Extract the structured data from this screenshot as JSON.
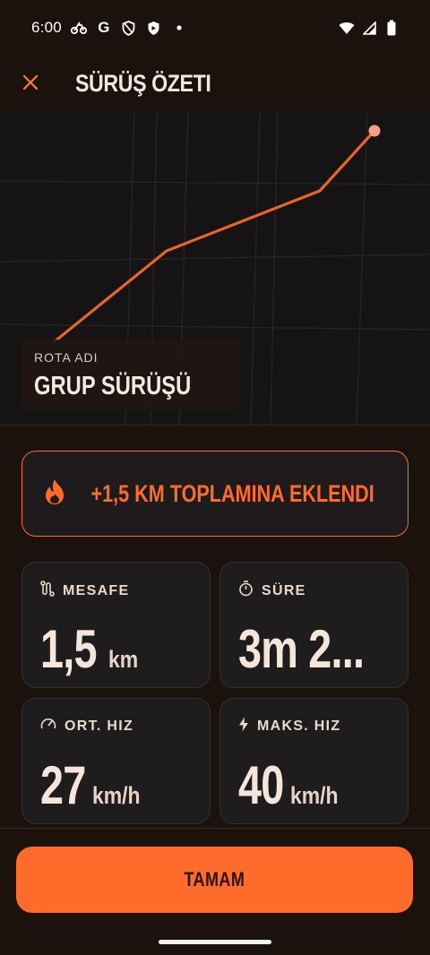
{
  "status_bar": {
    "time": "6:00",
    "left_icons": [
      "bike-notification-icon",
      "google-icon",
      "shield-icon",
      "vpn-shield-icon",
      "dot-icon"
    ],
    "right_icons": [
      "wifi-icon",
      "signal-icon",
      "battery-icon"
    ]
  },
  "header": {
    "title": "SÜRÜŞ ÖZETI"
  },
  "map": {
    "route_label": "ROTA ADI",
    "route_name": "GRUP SÜRÜŞÜ",
    "route_color": "#e8652a",
    "end_marker_color": "#f4a182"
  },
  "banner": {
    "text": "+1,5 KM TOPLAMINA EKLENDI",
    "icon": "flame-icon",
    "accent": "#ff6b2b"
  },
  "stats": {
    "distance": {
      "label": "MESAFE",
      "value": "1,5",
      "unit": "km",
      "icon": "route-icon"
    },
    "duration": {
      "label": "SÜRE",
      "value": "3m 2...",
      "unit": "",
      "icon": "stopwatch-icon"
    },
    "avg_speed": {
      "label": "ORT. HIZ",
      "value": "27",
      "unit": "km/h",
      "icon": "speedometer-icon"
    },
    "max_speed": {
      "label": "MAKS. HIZ",
      "value": "40",
      "unit": "km/h",
      "icon": "lightning-icon"
    }
  },
  "footer": {
    "ok_label": "TAMAM"
  },
  "colors": {
    "accent": "#ff6b2b",
    "background": "#1c120d",
    "card": "#1f1c1e"
  }
}
